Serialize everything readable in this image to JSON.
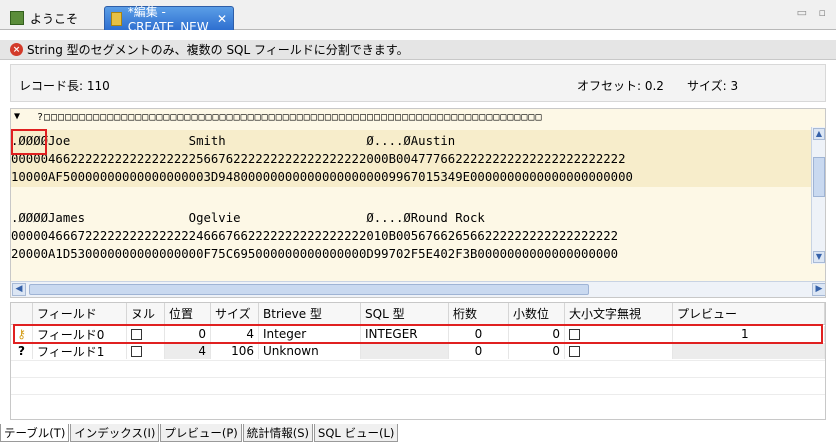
{
  "tabs": [
    {
      "label": "ようこそ",
      "icon": "pdf-icon"
    },
    {
      "label": "*編集 - CREATE_NEW",
      "icon": "edit-icon",
      "close": "✕"
    }
  ],
  "window_controls": "▭ ▫",
  "message": "String 型のセグメントのみ、複数の SQL フィールドに分割できます。",
  "info": {
    "record_length": "レコード長: 110",
    "offset": "オフセット: 0.2",
    "size": "サイズ: 3"
  },
  "hex": {
    "ruler_arrow": "▼",
    "ruler": "?□□□□□□□□□□□□□□□□□□□□□□□□□□□□□□□□□□□□□□□□□□□□□□□□□□□□□□□□□□□□□□□□□□□□□□□",
    "record1": {
      "text": ".ØØØØJoe                Smith                   Ø....ØAustin",
      "hi": "000004662222222222222222256676222222222222222222000B0047776622222222222222222222222",
      "lo": "10000AF50000000000000000003D948000000000000000000009967015349E0000000000000000000000"
    },
    "record2": {
      "text": ".ØØØØJames              Ogelvie                 Ø....ØRound Rock",
      "hi": "000004666722222222222222246667662222222222222222010B005676626566222222222222222222",
      "lo": "20000A1D530000000000000000F75C695000000000000000D99702F5E402F3B0000000000000000000"
    }
  },
  "grid": {
    "headers": [
      "フィールド",
      "ヌル",
      "位置",
      "サイズ",
      "Btrieve 型",
      "SQL 型",
      "桁数",
      "小数位",
      "大小文字無視",
      "プレビュー"
    ],
    "rows": [
      {
        "field": "フィールド0",
        "pos": "0",
        "size": "4",
        "btrieve": "Integer",
        "sql": "INTEGER",
        "digits": "0",
        "decimals": "0",
        "preview": "1"
      },
      {
        "field": "フィールド1",
        "pos": "4",
        "size": "106",
        "btrieve": "Unknown",
        "sql": "",
        "digits": "0",
        "decimals": "0",
        "preview": ""
      }
    ]
  },
  "bottom_tabs": [
    "テーブル(T)",
    "インデックス(I)",
    "プレビュー(P)",
    "統計情報(S)",
    "SQL ビュー(L)"
  ],
  "colors": {
    "selection_outline": "#e02020",
    "hex_background": "#fdf8e6",
    "active_tab": "#2e6fd0",
    "error": "#d33b2a"
  }
}
